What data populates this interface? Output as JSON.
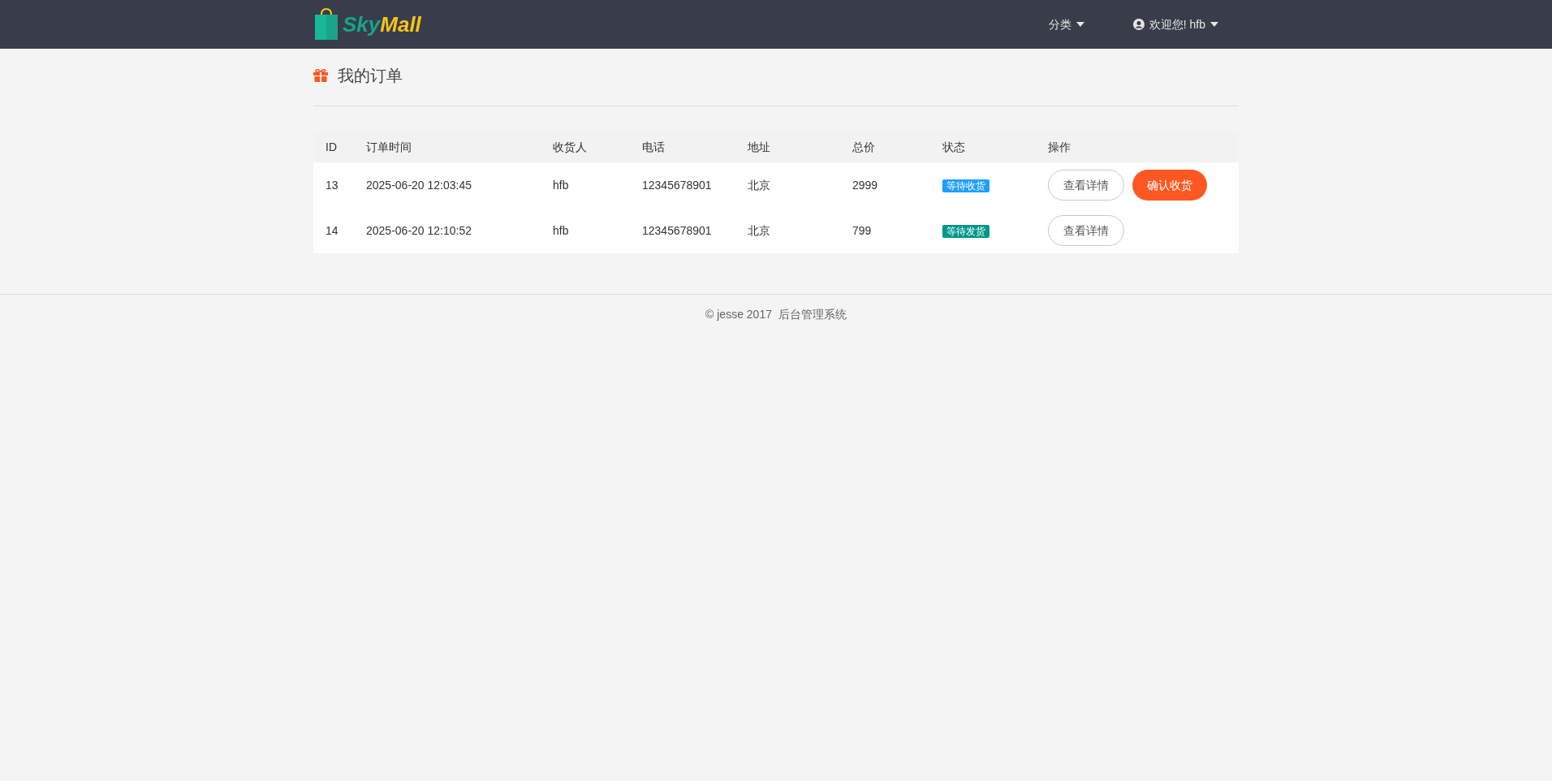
{
  "header": {
    "logo": {
      "first": "Sky",
      "second": "Mall"
    },
    "nav": [
      {
        "label": "分类",
        "user": false
      },
      {
        "label": "欢迎您! hfb",
        "user": true
      }
    ]
  },
  "page_title": "我的订单",
  "table": {
    "columns": [
      "ID",
      "订单时间",
      "收货人",
      "电话",
      "地址",
      "总价",
      "状态",
      "操作"
    ],
    "rows": [
      {
        "cells": [
          "13",
          "2025-06-20 12:03:45",
          "hfb",
          "12345678901",
          "北京",
          "2999"
        ],
        "status": {
          "label": "等待收货",
          "color": "#1e9fff"
        },
        "actions": [
          {
            "label": "查看详情",
            "kind": "outline"
          },
          {
            "label": "确认收货",
            "kind": "primary"
          }
        ]
      },
      {
        "cells": [
          "14",
          "2025-06-20 12:10:52",
          "hfb",
          "12345678901",
          "北京",
          "799"
        ],
        "status": {
          "label": "等待发货",
          "color": "#009688"
        },
        "actions": [
          {
            "label": "查看详情",
            "kind": "outline"
          }
        ]
      }
    ]
  },
  "footer": {
    "copyright": "© jesse 2017",
    "system": "后台管理系统"
  }
}
